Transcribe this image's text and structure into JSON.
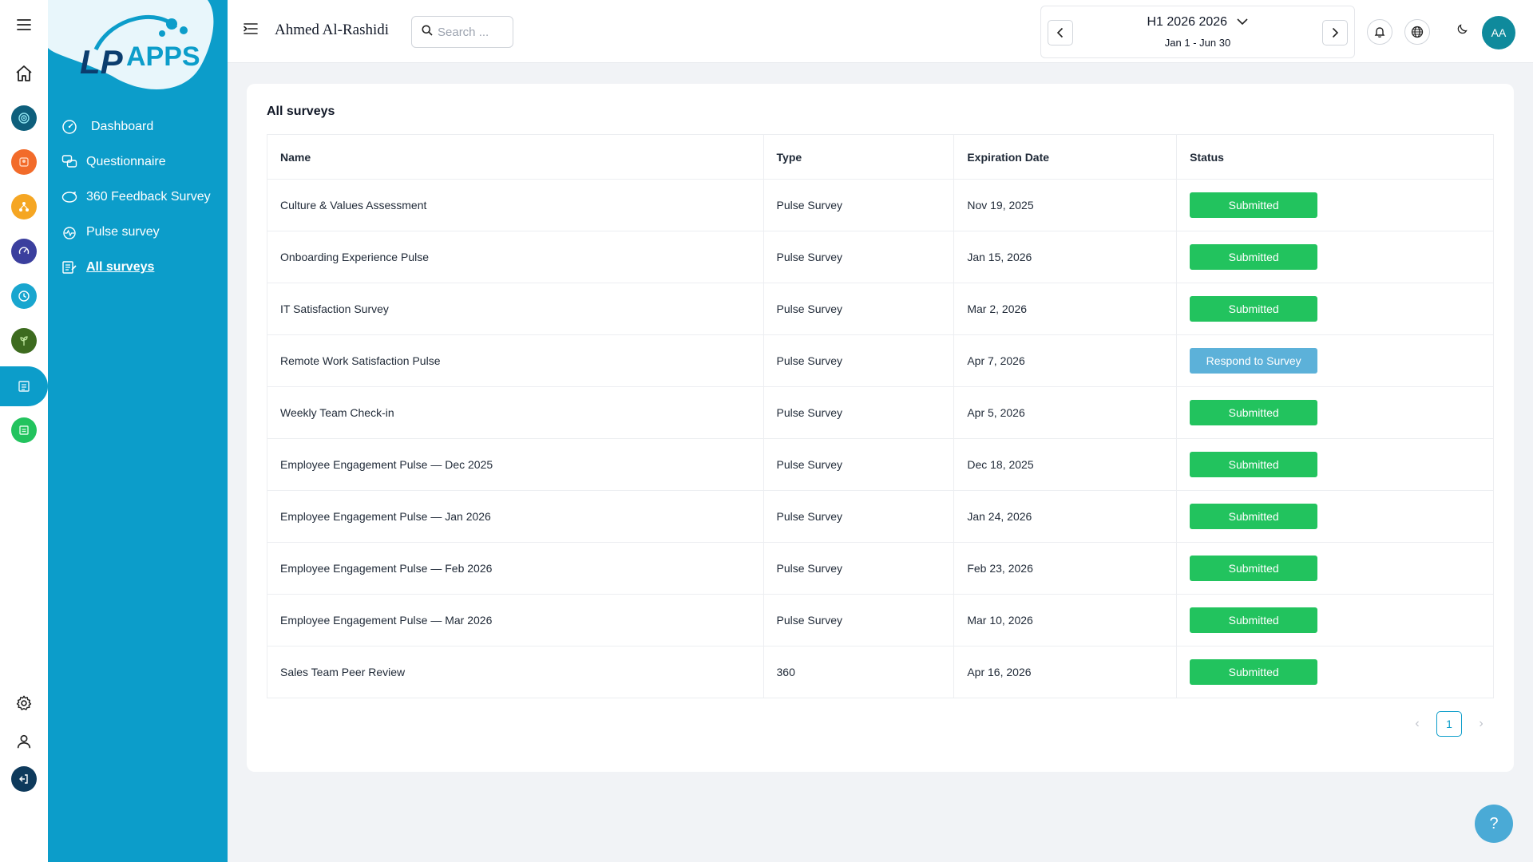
{
  "app": {
    "logo_text": "APPS",
    "logo_prefix": "LP"
  },
  "sidebar": {
    "items": [
      {
        "label": "Dashboard",
        "icon": "gauge-icon"
      },
      {
        "label": "Questionnaire",
        "icon": "chat-bubbles-icon"
      },
      {
        "label": "360 Feedback Survey",
        "icon": "feedback-360-icon"
      },
      {
        "label": "Pulse survey",
        "icon": "pulse-survey-icon"
      },
      {
        "label": "All surveys",
        "icon": "surveys-list-icon"
      }
    ]
  },
  "rail": {
    "apps": [
      {
        "name": "target-app",
        "color": "#0e5f7c"
      },
      {
        "name": "people-app",
        "color": "#f26b2a"
      },
      {
        "name": "network-app",
        "color": "#f5a623"
      },
      {
        "name": "speedometer-app",
        "color": "#3b3f9e"
      },
      {
        "name": "clock-app",
        "color": "#19a6cf"
      },
      {
        "name": "growth-app",
        "color": "#3d6b1f"
      },
      {
        "name": "survey-app",
        "color": "#0c9dca"
      },
      {
        "name": "report-app",
        "color": "#22c35e"
      }
    ],
    "logout_color": "#0e3a5c"
  },
  "header": {
    "user_name": "Ahmed Al-Rashidi",
    "search_placeholder": "Search ...",
    "period_title": "H1 2026 2026",
    "period_range": "Jan 1 - Jun 30",
    "avatar_initials": "AA",
    "avatar_color": "#0f8a9c"
  },
  "main": {
    "title": "All surveys",
    "columns": [
      "Name",
      "Type",
      "Expiration Date",
      "Status"
    ],
    "rows": [
      {
        "name": "Culture & Values Assessment",
        "type": "Pulse Survey",
        "expiration": "Nov 19, 2025",
        "status": "Submitted",
        "kind": "submitted"
      },
      {
        "name": "Onboarding Experience Pulse",
        "type": "Pulse Survey",
        "expiration": "Jan 15, 2026",
        "status": "Submitted",
        "kind": "submitted"
      },
      {
        "name": "IT Satisfaction Survey",
        "type": "Pulse Survey",
        "expiration": "Mar 2, 2026",
        "status": "Submitted",
        "kind": "submitted"
      },
      {
        "name": "Remote Work Satisfaction Pulse",
        "type": "Pulse Survey",
        "expiration": "Apr 7, 2026",
        "status": "Respond to Survey",
        "kind": "respond"
      },
      {
        "name": "Weekly Team Check-in",
        "type": "Pulse Survey",
        "expiration": "Apr 5, 2026",
        "status": "Submitted",
        "kind": "submitted"
      },
      {
        "name": "Employee Engagement Pulse — Dec 2025",
        "type": "Pulse Survey",
        "expiration": "Dec 18, 2025",
        "status": "Submitted",
        "kind": "submitted"
      },
      {
        "name": "Employee Engagement Pulse — Jan 2026",
        "type": "Pulse Survey",
        "expiration": "Jan 24, 2026",
        "status": "Submitted",
        "kind": "submitted"
      },
      {
        "name": "Employee Engagement Pulse — Feb 2026",
        "type": "Pulse Survey",
        "expiration": "Feb 23, 2026",
        "status": "Submitted",
        "kind": "submitted"
      },
      {
        "name": "Employee Engagement Pulse — Mar 2026",
        "type": "Pulse Survey",
        "expiration": "Mar 10, 2026",
        "status": "Submitted",
        "kind": "submitted"
      },
      {
        "name": "Sales Team Peer Review",
        "type": "360",
        "expiration": "Apr 16, 2026",
        "status": "Submitted",
        "kind": "submitted"
      }
    ],
    "pagination": {
      "current": "1"
    }
  },
  "help": {
    "label": "?"
  },
  "colors": {
    "brand": "#0c9dca",
    "submitted": "#22c35e",
    "respond": "#5cb1d9"
  }
}
